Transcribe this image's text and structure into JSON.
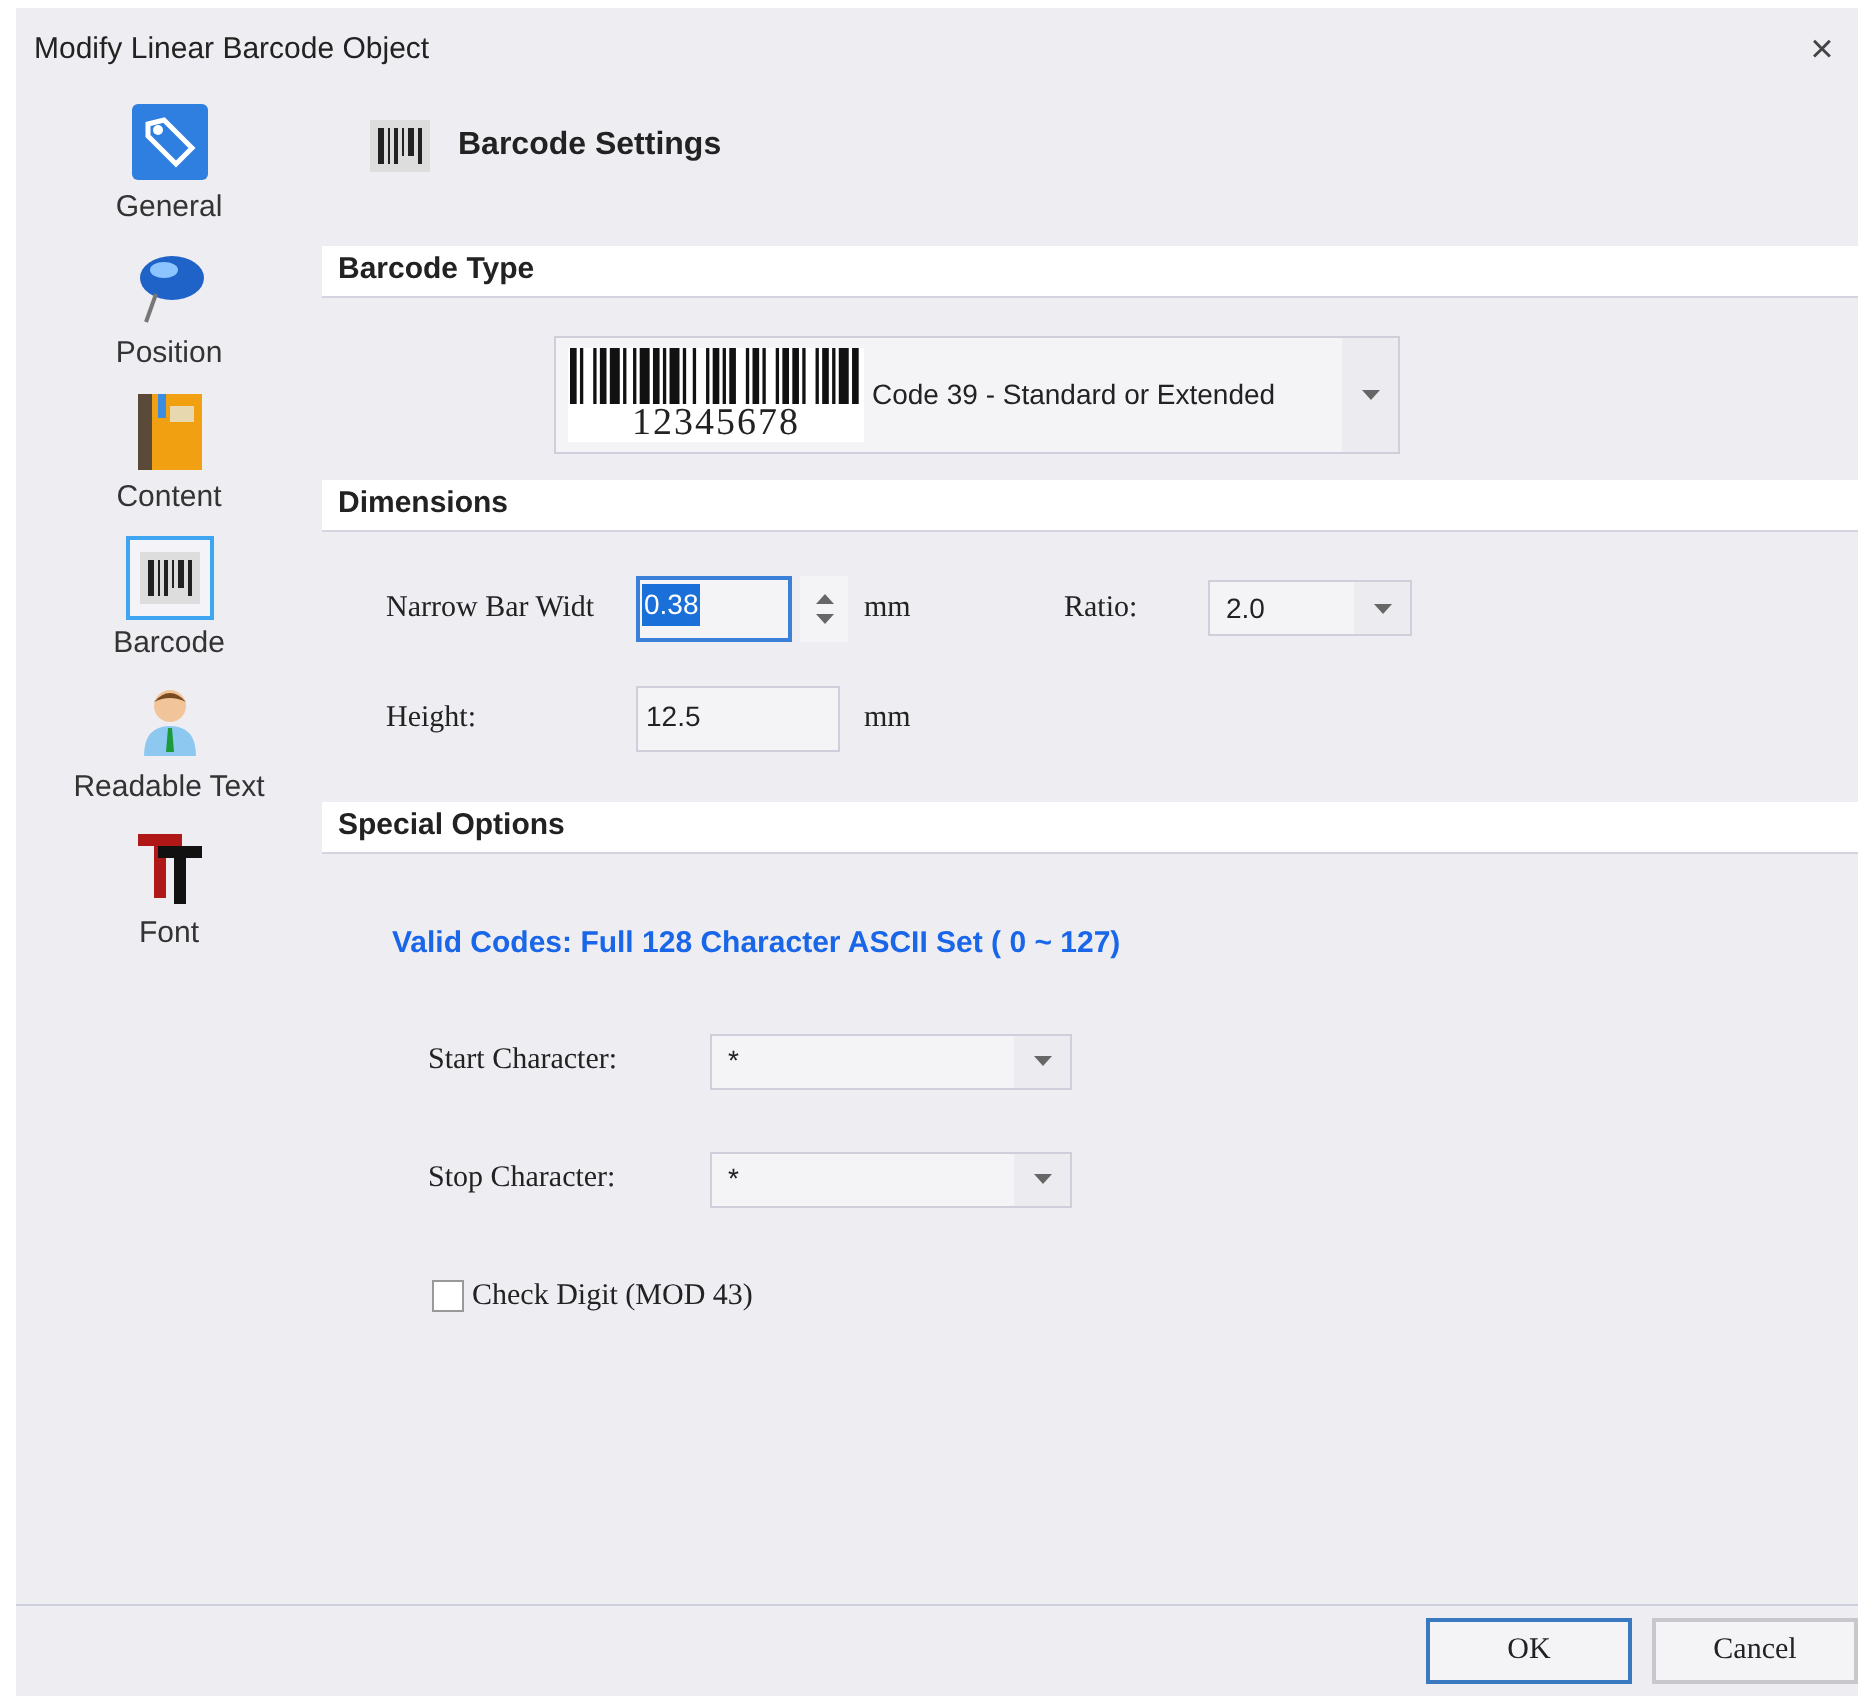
{
  "window": {
    "title": "Modify Linear Barcode Object",
    "close": "×"
  },
  "sidebar": {
    "items": [
      {
        "label": "General",
        "selected": false
      },
      {
        "label": "Position",
        "selected": false
      },
      {
        "label": "Content",
        "selected": false
      },
      {
        "label": "Barcode",
        "selected": true
      },
      {
        "label": "Readable Text",
        "selected": false
      },
      {
        "label": "Font",
        "selected": false
      }
    ]
  },
  "page_title": "Barcode Settings",
  "barcode_type": {
    "heading": "Barcode Type",
    "preview_digits": "12345678",
    "value": "Code 39 - Standard or Extended"
  },
  "dimensions": {
    "heading": "Dimensions",
    "narrow_bar_width": {
      "label": "Narrow Bar Widt",
      "value": "0.38",
      "unit": "mm",
      "text_selected": true
    },
    "ratio": {
      "label": "Ratio:",
      "value": "2.0"
    },
    "height": {
      "label": "Height:",
      "value": "12.5",
      "unit": "mm"
    }
  },
  "special_options": {
    "heading": "Special Options",
    "valid_codes": "Valid Codes: Full 128 Character ASCII Set ( 0 ~ 127)",
    "start_character": {
      "label": "Start Character:",
      "value": "*"
    },
    "stop_character": {
      "label": "Stop Character:",
      "value": "*"
    },
    "check_digit": {
      "label": "Check Digit (MOD 43)",
      "checked": false
    }
  },
  "buttons": [
    {
      "label": "OK",
      "default": true
    },
    {
      "label": "Cancel",
      "default": false
    }
  ]
}
